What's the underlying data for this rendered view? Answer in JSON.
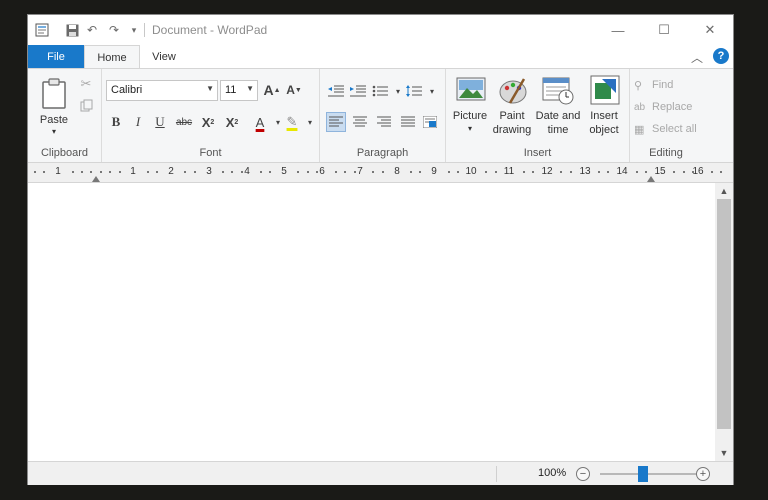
{
  "window": {
    "title": "Document - WordPad",
    "quick_access": {
      "app_icon": "wordpad-icon",
      "save_icon": "save-icon",
      "undo_icon": "undo-icon",
      "redo_icon": "redo-icon",
      "customize_icon": "customize-dropdown-icon"
    },
    "controls": {
      "minimize": "—",
      "maximize": "☐",
      "close": "✕"
    }
  },
  "tabs": {
    "file": "File",
    "home": "Home",
    "view": "View",
    "active": "Home",
    "help": "?"
  },
  "ribbon": {
    "clipboard": {
      "label": "Clipboard",
      "paste": "Paste",
      "paste_arrow": "▾"
    },
    "font": {
      "label": "Font",
      "font_family": "Calibri",
      "font_size": "11",
      "grow": "A",
      "shrink": "A",
      "bold": "B",
      "italic": "I",
      "underline": "U",
      "strikethrough": "abc",
      "subscript": "X",
      "superscript": "X",
      "text_color": "A",
      "highlight": "✎"
    },
    "paragraph": {
      "label": "Paragraph"
    },
    "insert": {
      "label": "Insert",
      "picture": "Picture",
      "picture_arrow": "▾",
      "paint_line1": "Paint",
      "paint_line2": "drawing",
      "date_line1": "Date and",
      "date_line2": "time",
      "object_line1": "Insert",
      "object_line2": "object"
    },
    "editing": {
      "label": "Editing",
      "find": "Find",
      "replace": "Replace",
      "select_all": "Select all"
    }
  },
  "ruler": {
    "numbers": [
      "1",
      "1",
      "2",
      "3",
      "4",
      "5",
      "6",
      "7",
      "8",
      "9",
      "10",
      "11",
      "12",
      "13",
      "14",
      "15",
      "16"
    ]
  },
  "statusbar": {
    "zoom": "100%",
    "zoom_level": 1.0,
    "zoom_out": "−",
    "zoom_in": "+"
  },
  "colors": {
    "accent": "#1979ca",
    "ribbon_bg": "#f5f6f7"
  }
}
